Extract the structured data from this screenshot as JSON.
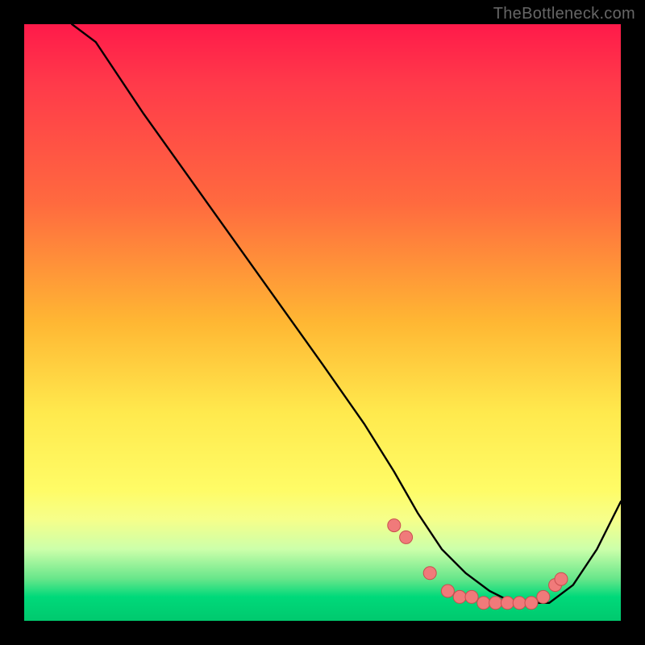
{
  "watermark": "TheBottleneck.com",
  "chart_data": {
    "type": "line",
    "title": "",
    "xlabel": "",
    "ylabel": "",
    "xlim": [
      0,
      100
    ],
    "ylim": [
      0,
      100
    ],
    "grid": false,
    "series": [
      {
        "name": "curve",
        "x": [
          8,
          12,
          20,
          30,
          40,
          50,
          57,
          62,
          66,
          70,
          74,
          78,
          82,
          85,
          88,
          92,
          96,
          100
        ],
        "values": [
          100,
          97,
          85,
          71,
          57,
          43,
          33,
          25,
          18,
          12,
          8,
          5,
          3,
          3,
          3,
          6,
          12,
          20
        ]
      }
    ],
    "markers": {
      "name": "highlighted-points",
      "x": [
        62,
        64,
        68,
        71,
        73,
        75,
        77,
        79,
        81,
        83,
        85,
        87,
        89,
        90
      ],
      "values": [
        16,
        14,
        8,
        5,
        4,
        4,
        3,
        3,
        3,
        3,
        3,
        4,
        6,
        7
      ]
    }
  }
}
